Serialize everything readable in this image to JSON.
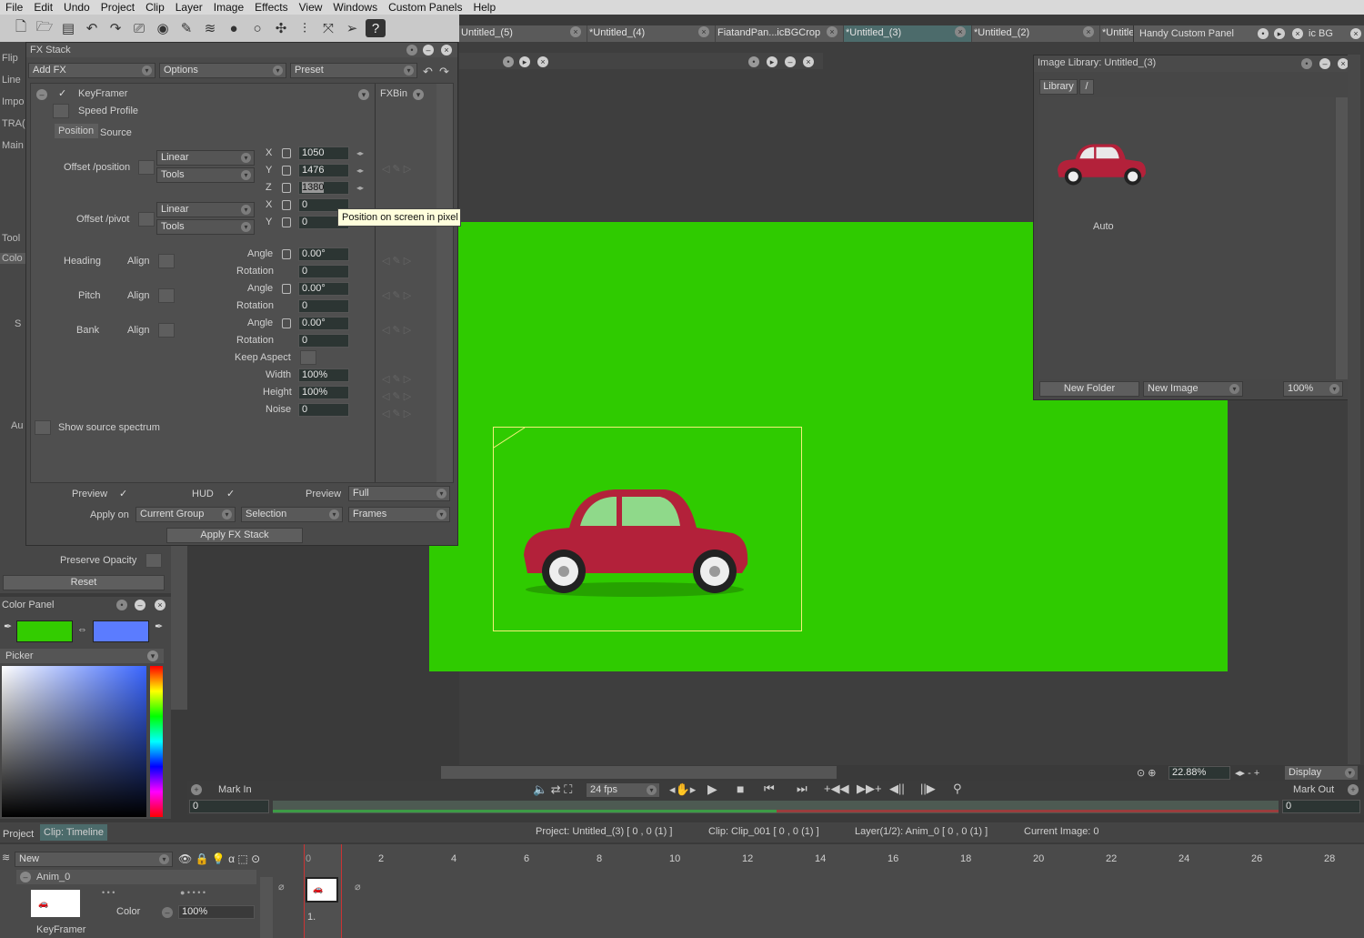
{
  "menu": [
    "File",
    "Edit",
    "Undo",
    "Project",
    "Clip",
    "Layer",
    "Image",
    "Effects",
    "View",
    "Windows",
    "Custom Panels",
    "Help"
  ],
  "doc_tabs": [
    {
      "label": "Untitled_(5)",
      "active": false
    },
    {
      "label": "*Untitled_(4)",
      "active": false
    },
    {
      "label": "FiatandPan...icBGCrop",
      "active": false
    },
    {
      "label": "*Untitled_(3)",
      "active": true
    },
    {
      "label": "*Untitled_(2)",
      "active": false
    },
    {
      "label": "*Untitle",
      "active": false
    }
  ],
  "custom_panel_tab": "Handy Custom Panel",
  "custom_panel_tab2": "ic BG",
  "left_strip": [
    "Flip",
    "Line",
    "Impo",
    "TRA(",
    "Main"
  ],
  "left_strip2": [
    "Tool",
    "Colo",
    "S",
    "Au"
  ],
  "fx_stack": {
    "title": "FX Stack",
    "add_fx": "Add FX",
    "options": "Options",
    "preset": "Preset",
    "fx_name": "KeyFramer",
    "speed_profile": "Speed Profile",
    "fxbin": "FXBin",
    "tab_position": "Position",
    "tab_source": "Source",
    "offset_position": "Offset /position",
    "offset_pivot": "Offset /pivot",
    "linear": "Linear",
    "tools": "Tools",
    "x": "X",
    "y": "Y",
    "z": "Z",
    "pos_x": "1050",
    "pos_y": "1476",
    "pos_z": "1380",
    "pivot_x": "0",
    "pivot_y": "0",
    "heading": "Heading",
    "pitch": "Pitch",
    "bank": "Bank",
    "align": "Align",
    "angle": "Angle",
    "rotation": "Rotation",
    "heading_angle": "0.00°",
    "heading_rot": "0",
    "pitch_angle": "0.00°",
    "pitch_rot": "0",
    "bank_angle": "0.00°",
    "bank_rot": "0",
    "keep_aspect": "Keep Aspect",
    "width": "Width",
    "width_val": "100%",
    "height": "Height",
    "height_val": "100%",
    "noise": "Noise",
    "noise_val": "0",
    "show_source_spectrum": "Show source spectrum",
    "preview": "Preview",
    "hud": "HUD",
    "preview2": "Preview",
    "preview_full": "Full",
    "apply_on": "Apply on",
    "current_group": "Current Group",
    "selection": "Selection",
    "frames": "Frames",
    "apply_fx_stack": "Apply FX Stack"
  },
  "tooltip": "Position on screen in pixel",
  "preserve_opacity": "Preserve Opacity",
  "reset": "Reset",
  "color_panel": {
    "title": "Color Panel",
    "picker": "Picker",
    "color1": "#33cc00",
    "color2": "#5b7cff"
  },
  "image_library": {
    "title": "Image Library: Untitled_(3)",
    "library": "Library",
    "slash": "/",
    "thumb_label": "Auto",
    "new_folder": "New Folder",
    "new_image": "New Image",
    "zoom": "100%"
  },
  "transport": {
    "mark_in": "Mark In",
    "mark_out": "Mark Out",
    "fps": "24 fps",
    "zoom": "22.88%",
    "display": "Display",
    "in_val": "0",
    "out_val": "0"
  },
  "status": {
    "project_tab": "Project",
    "clip_tab": "Clip: Timeline",
    "project": "Project: Untitled_(3) [ 0 , 0  (1) ]",
    "clip": "Clip: Clip_001 [ 0 , 0  (1) ]",
    "layer": "Layer(1/2): Anim_0 [ 0 , 0  (1) ]",
    "current_image": "Current Image: 0"
  },
  "timeline": {
    "new": "New",
    "layer": "Anim_0",
    "color": "Color",
    "opacity": "100%",
    "keyframer": "KeyFramer",
    "ticks": [
      "0",
      "2",
      "4",
      "6",
      "8",
      "10",
      "12",
      "14",
      "16",
      "18",
      "20",
      "22",
      "24",
      "26",
      "28"
    ],
    "frame_label": "1."
  }
}
